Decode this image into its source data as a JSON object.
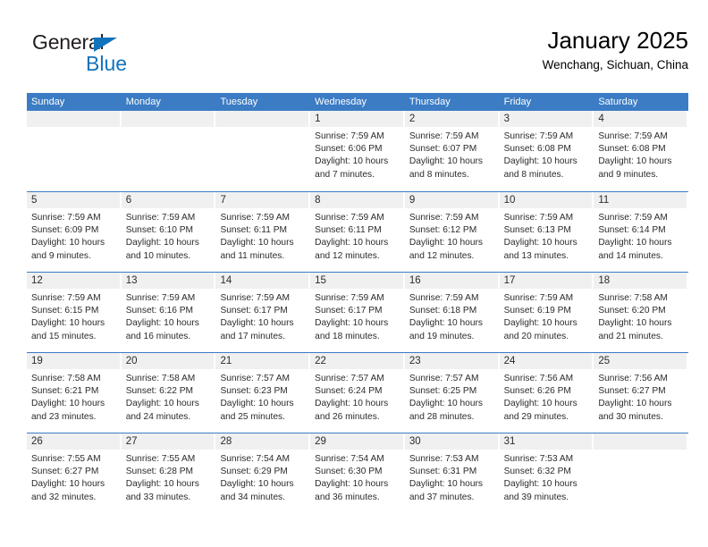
{
  "logo": {
    "word_top": "General",
    "word_bottom": "Blue",
    "triangle_color": "#1273bd"
  },
  "header": {
    "title": "January 2025",
    "subtitle": "Wenchang, Sichuan, China"
  },
  "theme": {
    "header_blue": "#3b7cc4",
    "daynum_bg": "#f0f0f0",
    "text": "#2b2b2b"
  },
  "weekdays": [
    "Sunday",
    "Monday",
    "Tuesday",
    "Wednesday",
    "Thursday",
    "Friday",
    "Saturday"
  ],
  "weeks": [
    [
      {
        "day": "",
        "lines": []
      },
      {
        "day": "",
        "lines": []
      },
      {
        "day": "",
        "lines": []
      },
      {
        "day": "1",
        "lines": [
          "Sunrise: 7:59 AM",
          "Sunset: 6:06 PM",
          "Daylight: 10 hours",
          "and 7 minutes."
        ]
      },
      {
        "day": "2",
        "lines": [
          "Sunrise: 7:59 AM",
          "Sunset: 6:07 PM",
          "Daylight: 10 hours",
          "and 8 minutes."
        ]
      },
      {
        "day": "3",
        "lines": [
          "Sunrise: 7:59 AM",
          "Sunset: 6:08 PM",
          "Daylight: 10 hours",
          "and 8 minutes."
        ]
      },
      {
        "day": "4",
        "lines": [
          "Sunrise: 7:59 AM",
          "Sunset: 6:08 PM",
          "Daylight: 10 hours",
          "and 9 minutes."
        ]
      }
    ],
    [
      {
        "day": "5",
        "lines": [
          "Sunrise: 7:59 AM",
          "Sunset: 6:09 PM",
          "Daylight: 10 hours",
          "and 9 minutes."
        ]
      },
      {
        "day": "6",
        "lines": [
          "Sunrise: 7:59 AM",
          "Sunset: 6:10 PM",
          "Daylight: 10 hours",
          "and 10 minutes."
        ]
      },
      {
        "day": "7",
        "lines": [
          "Sunrise: 7:59 AM",
          "Sunset: 6:11 PM",
          "Daylight: 10 hours",
          "and 11 minutes."
        ]
      },
      {
        "day": "8",
        "lines": [
          "Sunrise: 7:59 AM",
          "Sunset: 6:11 PM",
          "Daylight: 10 hours",
          "and 12 minutes."
        ]
      },
      {
        "day": "9",
        "lines": [
          "Sunrise: 7:59 AM",
          "Sunset: 6:12 PM",
          "Daylight: 10 hours",
          "and 12 minutes."
        ]
      },
      {
        "day": "10",
        "lines": [
          "Sunrise: 7:59 AM",
          "Sunset: 6:13 PM",
          "Daylight: 10 hours",
          "and 13 minutes."
        ]
      },
      {
        "day": "11",
        "lines": [
          "Sunrise: 7:59 AM",
          "Sunset: 6:14 PM",
          "Daylight: 10 hours",
          "and 14 minutes."
        ]
      }
    ],
    [
      {
        "day": "12",
        "lines": [
          "Sunrise: 7:59 AM",
          "Sunset: 6:15 PM",
          "Daylight: 10 hours",
          "and 15 minutes."
        ]
      },
      {
        "day": "13",
        "lines": [
          "Sunrise: 7:59 AM",
          "Sunset: 6:16 PM",
          "Daylight: 10 hours",
          "and 16 minutes."
        ]
      },
      {
        "day": "14",
        "lines": [
          "Sunrise: 7:59 AM",
          "Sunset: 6:17 PM",
          "Daylight: 10 hours",
          "and 17 minutes."
        ]
      },
      {
        "day": "15",
        "lines": [
          "Sunrise: 7:59 AM",
          "Sunset: 6:17 PM",
          "Daylight: 10 hours",
          "and 18 minutes."
        ]
      },
      {
        "day": "16",
        "lines": [
          "Sunrise: 7:59 AM",
          "Sunset: 6:18 PM",
          "Daylight: 10 hours",
          "and 19 minutes."
        ]
      },
      {
        "day": "17",
        "lines": [
          "Sunrise: 7:59 AM",
          "Sunset: 6:19 PM",
          "Daylight: 10 hours",
          "and 20 minutes."
        ]
      },
      {
        "day": "18",
        "lines": [
          "Sunrise: 7:58 AM",
          "Sunset: 6:20 PM",
          "Daylight: 10 hours",
          "and 21 minutes."
        ]
      }
    ],
    [
      {
        "day": "19",
        "lines": [
          "Sunrise: 7:58 AM",
          "Sunset: 6:21 PM",
          "Daylight: 10 hours",
          "and 23 minutes."
        ]
      },
      {
        "day": "20",
        "lines": [
          "Sunrise: 7:58 AM",
          "Sunset: 6:22 PM",
          "Daylight: 10 hours",
          "and 24 minutes."
        ]
      },
      {
        "day": "21",
        "lines": [
          "Sunrise: 7:57 AM",
          "Sunset: 6:23 PM",
          "Daylight: 10 hours",
          "and 25 minutes."
        ]
      },
      {
        "day": "22",
        "lines": [
          "Sunrise: 7:57 AM",
          "Sunset: 6:24 PM",
          "Daylight: 10 hours",
          "and 26 minutes."
        ]
      },
      {
        "day": "23",
        "lines": [
          "Sunrise: 7:57 AM",
          "Sunset: 6:25 PM",
          "Daylight: 10 hours",
          "and 28 minutes."
        ]
      },
      {
        "day": "24",
        "lines": [
          "Sunrise: 7:56 AM",
          "Sunset: 6:26 PM",
          "Daylight: 10 hours",
          "and 29 minutes."
        ]
      },
      {
        "day": "25",
        "lines": [
          "Sunrise: 7:56 AM",
          "Sunset: 6:27 PM",
          "Daylight: 10 hours",
          "and 30 minutes."
        ]
      }
    ],
    [
      {
        "day": "26",
        "lines": [
          "Sunrise: 7:55 AM",
          "Sunset: 6:27 PM",
          "Daylight: 10 hours",
          "and 32 minutes."
        ]
      },
      {
        "day": "27",
        "lines": [
          "Sunrise: 7:55 AM",
          "Sunset: 6:28 PM",
          "Daylight: 10 hours",
          "and 33 minutes."
        ]
      },
      {
        "day": "28",
        "lines": [
          "Sunrise: 7:54 AM",
          "Sunset: 6:29 PM",
          "Daylight: 10 hours",
          "and 34 minutes."
        ]
      },
      {
        "day": "29",
        "lines": [
          "Sunrise: 7:54 AM",
          "Sunset: 6:30 PM",
          "Daylight: 10 hours",
          "and 36 minutes."
        ]
      },
      {
        "day": "30",
        "lines": [
          "Sunrise: 7:53 AM",
          "Sunset: 6:31 PM",
          "Daylight: 10 hours",
          "and 37 minutes."
        ]
      },
      {
        "day": "31",
        "lines": [
          "Sunrise: 7:53 AM",
          "Sunset: 6:32 PM",
          "Daylight: 10 hours",
          "and 39 minutes."
        ]
      },
      {
        "day": "",
        "lines": []
      }
    ]
  ]
}
